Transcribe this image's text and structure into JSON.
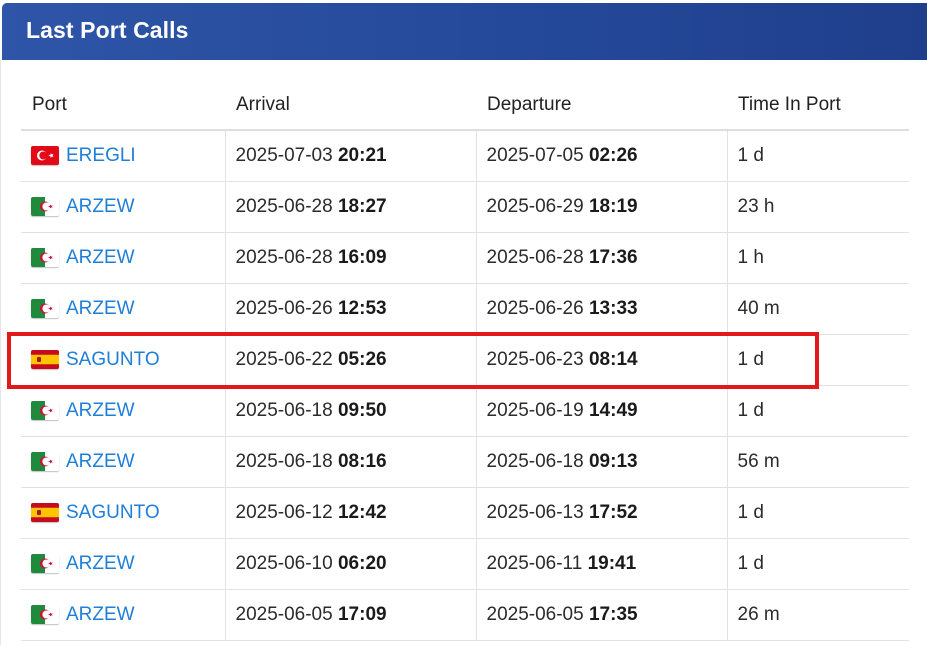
{
  "panel": {
    "title": "Last Port Calls"
  },
  "table": {
    "headers": {
      "port": "Port",
      "arrival": "Arrival",
      "departure": "Departure",
      "time_in_port": "Time In Port"
    },
    "rows": [
      {
        "flag": "turkey-flag-icon",
        "port": "EREGLI",
        "arrival_date": "2025-07-03",
        "arrival_time": "20:21",
        "departure_date": "2025-07-05",
        "departure_time": "02:26",
        "time_in_port": "1 d"
      },
      {
        "flag": "algeria-flag-icon",
        "port": "ARZEW",
        "arrival_date": "2025-06-28",
        "arrival_time": "18:27",
        "departure_date": "2025-06-29",
        "departure_time": "18:19",
        "time_in_port": "23 h"
      },
      {
        "flag": "algeria-flag-icon",
        "port": "ARZEW",
        "arrival_date": "2025-06-28",
        "arrival_time": "16:09",
        "departure_date": "2025-06-28",
        "departure_time": "17:36",
        "time_in_port": "1 h"
      },
      {
        "flag": "algeria-flag-icon",
        "port": "ARZEW",
        "arrival_date": "2025-06-26",
        "arrival_time": "12:53",
        "departure_date": "2025-06-26",
        "departure_time": "13:33",
        "time_in_port": "40 m"
      },
      {
        "flag": "spain-flag-icon",
        "port": "SAGUNTO",
        "arrival_date": "2025-06-22",
        "arrival_time": "05:26",
        "departure_date": "2025-06-23",
        "departure_time": "08:14",
        "time_in_port": "1 d",
        "highlighted": true
      },
      {
        "flag": "algeria-flag-icon",
        "port": "ARZEW",
        "arrival_date": "2025-06-18",
        "arrival_time": "09:50",
        "departure_date": "2025-06-19",
        "departure_time": "14:49",
        "time_in_port": "1 d"
      },
      {
        "flag": "algeria-flag-icon",
        "port": "ARZEW",
        "arrival_date": "2025-06-18",
        "arrival_time": "08:16",
        "departure_date": "2025-06-18",
        "departure_time": "09:13",
        "time_in_port": "56 m"
      },
      {
        "flag": "spain-flag-icon",
        "port": "SAGUNTO",
        "arrival_date": "2025-06-12",
        "arrival_time": "12:42",
        "departure_date": "2025-06-13",
        "departure_time": "17:52",
        "time_in_port": "1 d"
      },
      {
        "flag": "algeria-flag-icon",
        "port": "ARZEW",
        "arrival_date": "2025-06-10",
        "arrival_time": "06:20",
        "departure_date": "2025-06-11",
        "departure_time": "19:41",
        "time_in_port": "1 d"
      },
      {
        "flag": "algeria-flag-icon",
        "port": "ARZEW",
        "arrival_date": "2025-06-05",
        "arrival_time": "17:09",
        "departure_date": "2025-06-05",
        "departure_time": "17:35",
        "time_in_port": "26 m"
      }
    ]
  },
  "colors": {
    "header_bg": "#2a4fa0",
    "link": "#1e7fd8",
    "highlight_border": "#e01a1a"
  }
}
